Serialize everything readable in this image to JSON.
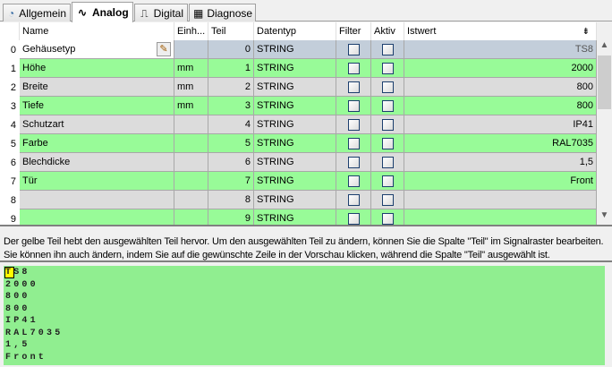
{
  "tabs": [
    {
      "label": "Allgemein",
      "icon": "gauge-icon"
    },
    {
      "label": "Analog",
      "icon": "sine-wave-icon",
      "active": true
    },
    {
      "label": "Digital",
      "icon": "pulse-icon"
    },
    {
      "label": "Diagnose",
      "icon": "chip-icon"
    }
  ],
  "grid": {
    "headers": {
      "name": "Name",
      "einh": "Einh...",
      "teil": "Teil",
      "datentyp": "Datentyp",
      "filter": "Filter",
      "aktiv": "Aktiv",
      "istwert": "Istwert"
    },
    "rows": [
      {
        "idx": "0",
        "name": "Gehäusetyp",
        "einh": "",
        "teil": "0",
        "typ": "STRING",
        "ist": "TS8"
      },
      {
        "idx": "1",
        "name": "Höhe",
        "einh": "mm",
        "teil": "1",
        "typ": "STRING",
        "ist": "2000"
      },
      {
        "idx": "2",
        "name": "Breite",
        "einh": "mm",
        "teil": "2",
        "typ": "STRING",
        "ist": "800"
      },
      {
        "idx": "3",
        "name": "Tiefe",
        "einh": "mm",
        "teil": "3",
        "typ": "STRING",
        "ist": "800"
      },
      {
        "idx": "4",
        "name": "Schutzart",
        "einh": "",
        "teil": "4",
        "typ": "STRING",
        "ist": "IP41"
      },
      {
        "idx": "5",
        "name": "Farbe",
        "einh": "",
        "teil": "5",
        "typ": "STRING",
        "ist": "RAL7035"
      },
      {
        "idx": "6",
        "name": "Blechdicke",
        "einh": "",
        "teil": "6",
        "typ": "STRING",
        "ist": "1,5"
      },
      {
        "idx": "7",
        "name": "Tür",
        "einh": "",
        "teil": "7",
        "typ": "STRING",
        "ist": "Front"
      },
      {
        "idx": "8",
        "name": "",
        "einh": "",
        "teil": "8",
        "typ": "STRING",
        "ist": ""
      },
      {
        "idx": "9",
        "name": "",
        "einh": "",
        "teil": "9",
        "typ": "STRING",
        "ist": ""
      }
    ]
  },
  "help_text": "Der gelbe Teil hebt den ausgewählten Teil hervor. Um den ausgewählten Teil zu ändern, können Sie die Spalte \"Teil\" im Signalraster bearbeiten. Sie können ihn auch ändern, indem Sie auf die gewünschte Zeile in der Vorschau klicken, während die Spalte \"Teil\" ausgewählt ist.",
  "preview": {
    "highlight": "T",
    "first_rest": "S8",
    "lines": [
      "2000",
      "800",
      "800",
      "IP41",
      "RAL7035",
      "1,5",
      "Front"
    ]
  }
}
